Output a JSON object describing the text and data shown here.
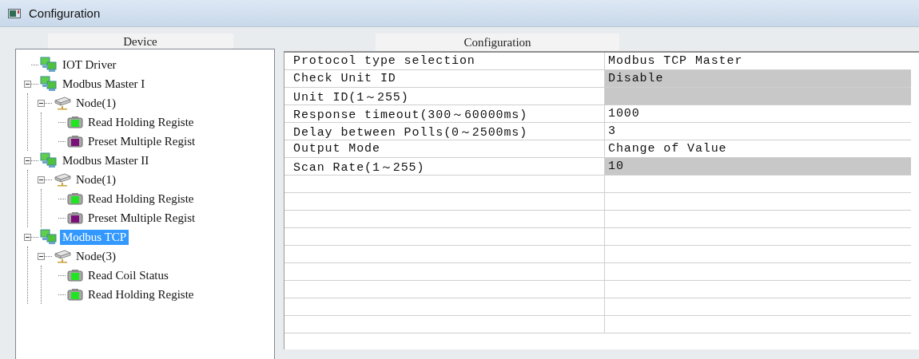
{
  "window": {
    "title": "Configuration"
  },
  "device_panel": {
    "header": "Device",
    "tree": [
      {
        "label": "IOT Driver",
        "kind": "driver",
        "selected": false
      },
      {
        "label": "Modbus Master I",
        "kind": "driver",
        "selected": false,
        "expanded": true,
        "children": [
          {
            "label": "Node(1)",
            "kind": "node",
            "selected": false,
            "expanded": true,
            "children": [
              {
                "label": "Read Holding Registe",
                "kind": "register",
                "color": "#22e522",
                "selected": false
              },
              {
                "label": "Preset Multiple Regist",
                "kind": "register",
                "color": "#7a0f7a",
                "selected": false
              }
            ]
          }
        ]
      },
      {
        "label": "Modbus Master II",
        "kind": "driver",
        "selected": false,
        "expanded": true,
        "children": [
          {
            "label": "Node(1)",
            "kind": "node",
            "selected": false,
            "expanded": true,
            "children": [
              {
                "label": "Read Holding Registe",
                "kind": "register",
                "color": "#22e522",
                "selected": false
              },
              {
                "label": "Preset Multiple Regist",
                "kind": "register",
                "color": "#7a0f7a",
                "selected": false
              }
            ]
          }
        ]
      },
      {
        "label": "Modbus TCP",
        "kind": "driver",
        "selected": true,
        "expanded": true,
        "children": [
          {
            "label": "Node(3)",
            "kind": "node",
            "selected": false,
            "expanded": true,
            "children": [
              {
                "label": "Read Coil Status",
                "kind": "register",
                "color": "#22e522",
                "selected": false
              },
              {
                "label": "Read Holding Registe",
                "kind": "register",
                "color": "#22e522",
                "selected": false
              }
            ]
          }
        ]
      }
    ]
  },
  "config_panel": {
    "header": "Configuration",
    "rows": [
      {
        "name": "Protocol type selection",
        "value": "Modbus TCP Master",
        "readonly": false
      },
      {
        "name": "Check Unit ID",
        "value": "Disable",
        "readonly": true
      },
      {
        "name": "Unit ID(1～255)",
        "readonly": true
      },
      {
        "name": "Response timeout(300～60000ms)",
        "value": "1000",
        "readonly": false
      },
      {
        "name": "Delay between Polls(0～2500ms)",
        "value": "3",
        "readonly": false
      },
      {
        "name": "Output Mode",
        "value": "Change of Value",
        "readonly": false
      },
      {
        "name": "Scan Rate(1～255)",
        "value": "10",
        "readonly": true
      }
    ]
  }
}
